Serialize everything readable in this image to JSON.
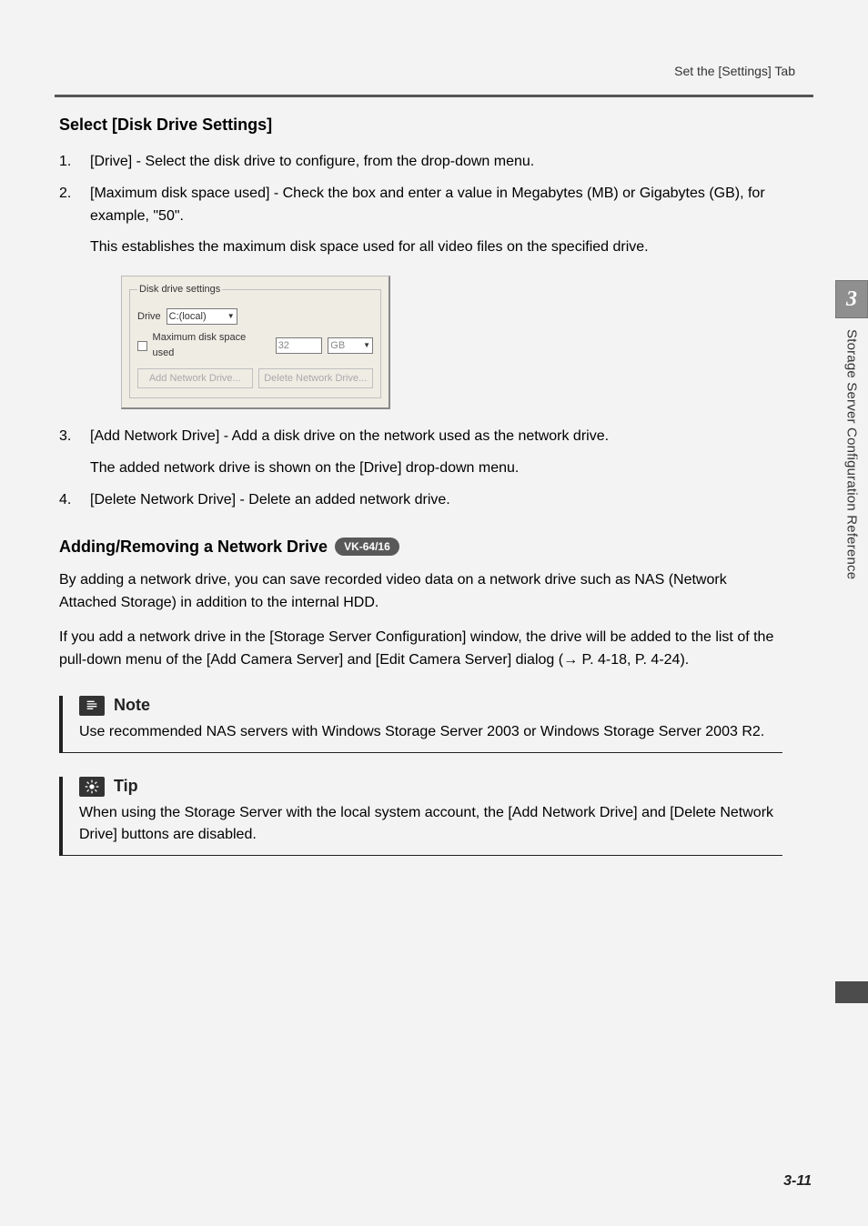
{
  "header": {
    "right_text": "Set the [Settings] Tab"
  },
  "section1": {
    "title": "Select [Disk Drive Settings]",
    "items": [
      {
        "num": "1.",
        "text_pre": "[Drive]",
        "text": " - Select the disk drive to configure, from the drop-down menu."
      },
      {
        "num": "2.",
        "text_pre": "[Maximum disk space used]",
        "text": " - Check the box and enter a value in Megabytes (MB) or Gigabytes (GB), for example, \"50\".",
        "sub": "This establishes the maximum disk space used for all video files on the specified drive."
      },
      {
        "num": "3.",
        "text_pre": "[Add Network Drive]",
        "text": " - Add a disk drive on the network used as the network drive.",
        "sub": "The added network drive is shown on the [Drive] drop-down menu."
      },
      {
        "num": "4.",
        "text_pre": "[Delete Network Drive]",
        "text": " - Delete an added network drive."
      }
    ]
  },
  "dialog": {
    "legend": "Disk drive settings",
    "drive_label": "Drive",
    "drive_value": "C:(local)",
    "checkbox_label": "Maximum disk space used",
    "value": "32",
    "unit": "GB",
    "btn_add": "Add Network Drive...",
    "btn_delete": "Delete Network Drive..."
  },
  "section2": {
    "title": "Adding/Removing a Network Drive",
    "badge": "VK-64/16",
    "p1": "By adding a network drive, you can save recorded video data on a network drive such as NAS (Network Attached Storage) in addition to the internal HDD.",
    "p2_a": "If you add a network drive in the [",
    "p2_b": "Storage Server Configuration",
    "p2_c": "] window, the drive will be added to the list of the pull-down menu of the [",
    "p2_d": "Add Camera Server",
    "p2_e": "] and [",
    "p2_f": "Edit Camera Server",
    "p2_g": "] dialog (→ P. 4-18, P. 4-24)."
  },
  "note": {
    "label": "Note",
    "text": "Use recommended NAS servers with Windows Storage Server 2003 or Windows Storage Server 2003 R2."
  },
  "tip": {
    "label": "Tip",
    "text_a": "When using the Storage Server with the local system account, the [",
    "text_b": "Add Network Drive",
    "text_c": "] and [",
    "text_d": "Delete Network Drive",
    "text_e": "] buttons are disabled."
  },
  "side": {
    "chapter_num": "3",
    "chapter_title": "Storage Server Configuration Reference"
  },
  "page_number": "3-11"
}
